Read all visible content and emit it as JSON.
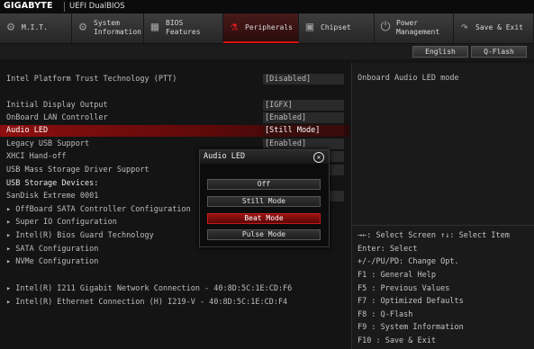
{
  "brand": {
    "vendor": "GIGABYTE",
    "product": "UEFI DualBIOS"
  },
  "tabs": [
    {
      "label": "M.I.T.",
      "icon": "gauge-icon",
      "active": false
    },
    {
      "label": "System\nInformation",
      "icon": "gear-icon",
      "active": false
    },
    {
      "label": "BIOS\nFeatures",
      "icon": "chip-icon",
      "active": false
    },
    {
      "label": "Peripherals",
      "icon": "usb-icon",
      "active": true
    },
    {
      "label": "Chipset",
      "icon": "chipset-icon",
      "active": false
    },
    {
      "label": "Power\nManagement",
      "icon": "power-icon",
      "active": false
    },
    {
      "label": "Save & Exit",
      "icon": "save-exit-icon",
      "active": false
    }
  ],
  "lang_buttons": {
    "language": "English",
    "qflash": "Q-Flash"
  },
  "items": {
    "ptt": {
      "label": "Intel Platform Trust Technology (PTT)",
      "value": "[Disabled]"
    },
    "display": {
      "label": "Initial Display Output",
      "value": "[IGFX]"
    },
    "lan": {
      "label": "OnBoard LAN Controller",
      "value": "[Enabled]"
    },
    "audio_led": {
      "label": "Audio LED",
      "value": "[Still Mode]"
    },
    "legacy_usb": {
      "label": "Legacy USB Support",
      "value": "[Enabled]"
    },
    "xhci": {
      "label": "XHCI Hand-off"
    },
    "usb_mass": {
      "label": "USB Mass Storage Driver Support"
    },
    "usb_devices": {
      "label": "USB Storage Devices:"
    },
    "usb_dev1": {
      "label": "SanDisk Extreme 0001"
    },
    "sata_ctrl": {
      "label": "OffBoard SATA Controller Configuration"
    },
    "super_io": {
      "label": "Super IO Configuration"
    },
    "bios_guard": {
      "label": "Intel(R) Bios Guard Technology"
    },
    "sata_cfg": {
      "label": "SATA Configuration"
    },
    "nvme": {
      "label": "NVMe Configuration"
    },
    "nic1": {
      "label": "Intel(R) I211 Gigabit  Network Connection - 40:8D:5C:1E:CD:F6"
    },
    "nic2": {
      "label": "Intel(R) Ethernet Connection (H) I219-V - 40:8D:5C:1E:CD:F4"
    }
  },
  "help_text": "Onboard Audio LED mode",
  "keys": [
    "→←: Select Screen  ↑↓: Select Item",
    "Enter: Select",
    "+/-/PU/PD: Change Opt.",
    "F1  : General Help",
    "F5  : Previous Values",
    "F7  : Optimized Defaults",
    "F8  : Q-Flash",
    "F9  : System Information",
    "F10 : Save & Exit"
  ],
  "popup": {
    "title": "Audio LED",
    "options": [
      "Off",
      "Still Mode",
      "Beat Mode",
      "Pulse Mode"
    ],
    "selected": "Beat Mode"
  }
}
